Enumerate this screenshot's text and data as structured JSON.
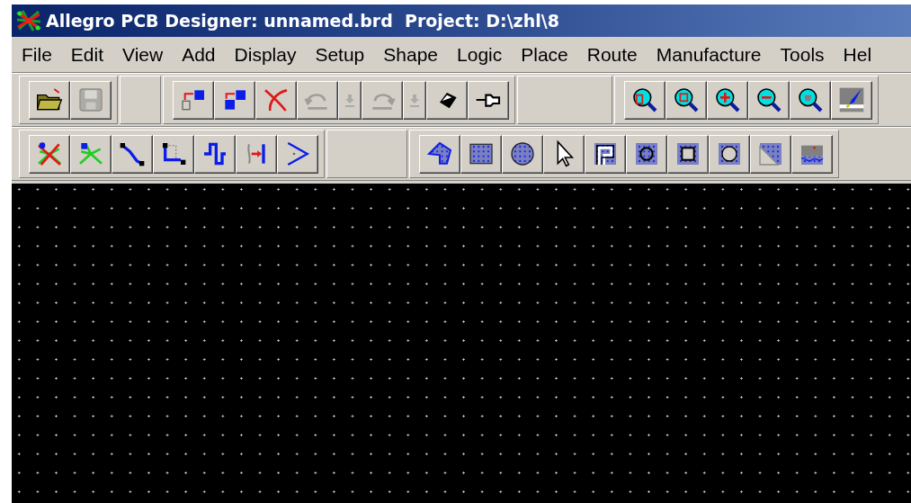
{
  "window": {
    "title": "Allegro PCB Designer: unnamed.brd  Project: D:\\zhl\\8"
  },
  "menu": [
    "File",
    "Edit",
    "View",
    "Add",
    "Display",
    "Setup",
    "Shape",
    "Logic",
    "Place",
    "Route",
    "Manufacture",
    "Tools",
    "Hel"
  ],
  "toolbar_rows": [
    {
      "toolbars": [
        {
          "buttons": [
            {
              "disabled": false
            },
            {
              "disabled": true
            }
          ]
        },
        {
          "buttons": [
            {
              "disabled": false
            },
            {
              "disabled": false
            },
            {
              "disabled": false
            },
            {
              "disabled": true,
              "dropdown": true
            },
            {
              "disabled": true,
              "dropdown": true
            },
            {
              "disabled": false
            },
            {
              "disabled": false
            }
          ]
        },
        {
          "buttons": [
            {
              "disabled": false
            },
            {
              "disabled": false
            },
            {
              "disabled": false
            },
            {
              "disabled": false
            },
            {
              "disabled": false
            },
            {
              "disabled": false
            }
          ]
        }
      ]
    },
    {
      "toolbars": [
        {
          "buttons": [
            {
              "disabled": false
            },
            {
              "disabled": false
            },
            {
              "disabled": false
            },
            {
              "disabled": false
            },
            {
              "disabled": false
            },
            {
              "disabled": false
            },
            {
              "disabled": false
            }
          ]
        },
        {
          "buttons": [
            {
              "disabled": false
            },
            {
              "disabled": false
            },
            {
              "disabled": false
            },
            {
              "disabled": false
            },
            {
              "disabled": false
            },
            {
              "disabled": false
            },
            {
              "disabled": false
            },
            {
              "disabled": false
            },
            {
              "disabled": false
            },
            {
              "disabled": false
            }
          ]
        }
      ]
    }
  ]
}
